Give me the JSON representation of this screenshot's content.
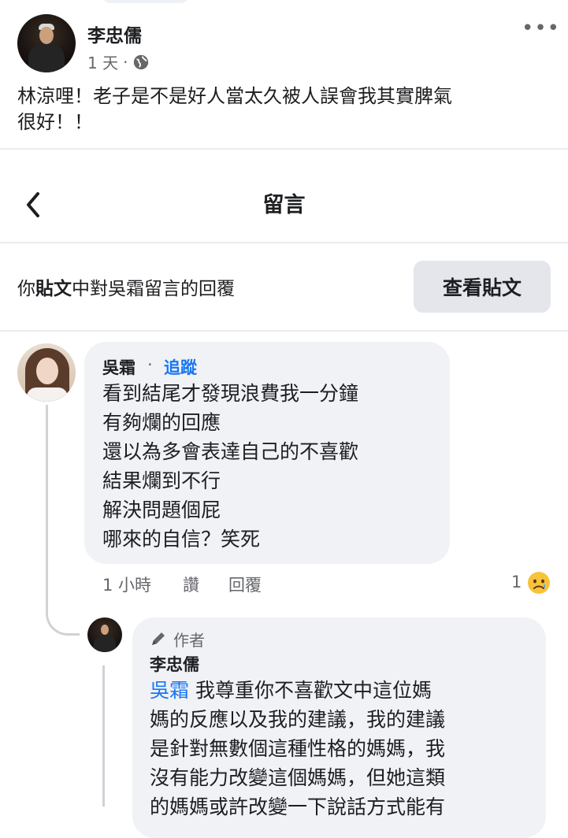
{
  "post": {
    "author": "李忠儒",
    "time": "1 天",
    "dot": "·",
    "text_line1": "林涼哩！老子是不是好人當太久被人誤會我其實脾氣",
    "text_line2": "很好！！"
  },
  "comments_header": {
    "title": "留言",
    "context_prefix": "你",
    "context_bold": "貼文",
    "context_suffix": "中對吳霜留言的回覆",
    "view_post_label": "查看貼文"
  },
  "comment": {
    "author": "吳霜",
    "dot": "·",
    "follow_label": "追蹤",
    "lines": [
      "看到結尾才發現浪費我一分鐘",
      "有夠爛的回應",
      "還以為多會表達自己的不喜歡",
      "結果爛到不行",
      "解決問題個屁",
      "哪來的自信？笑死"
    ],
    "time": "1 小時",
    "like_label": "讚",
    "reply_label": "回覆",
    "reaction_count": "1"
  },
  "reply": {
    "badge": "作者",
    "author": "李忠儒",
    "mention": "吳霜",
    "line1_rest": " 我尊重你不喜歡文中這位媽",
    "lines": [
      "媽的反應以及我的建議，我的建議",
      "是針對無數個這種性格的媽媽，我",
      "沒有能力改變這個媽媽，但她這類",
      "的媽媽或許改變一下說話方式能有"
    ]
  },
  "colors": {
    "accent": "#1877f2",
    "secondary_text": "#65676b",
    "bubble": "#f0f2f5",
    "button": "#e4e6eb"
  },
  "icons": [
    "globe-icon",
    "more-icon",
    "back-icon",
    "sad-reaction-icon",
    "pen-icon"
  ]
}
